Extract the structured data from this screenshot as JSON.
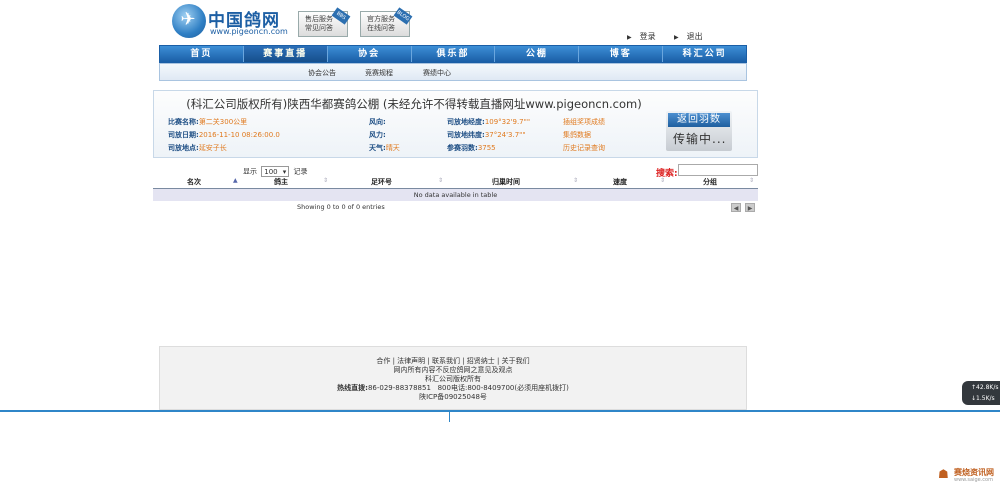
{
  "header": {
    "logo_cn": "中国鸽网",
    "logo_url": "www.pigeoncn.com",
    "service_buttons": [
      {
        "line1": "售后服务",
        "line2": "常见问答",
        "tag": "BBS"
      },
      {
        "line1": "官方服务",
        "line2": "在线问答",
        "tag": "BLOG"
      }
    ],
    "login": "登录",
    "logout": "退出"
  },
  "nav": {
    "items": [
      "首页",
      "赛事直播",
      "协会",
      "俱乐部",
      "公棚",
      "博客",
      "科汇公司"
    ],
    "active_index": 1,
    "sub_items": [
      "协会公告",
      "竞赛规程",
      "赛绩中心"
    ]
  },
  "race_info": {
    "title": "(科汇公司版权所有)陕西华都赛鸽公棚 (未经允许不得转载直播网址www.pigeoncn.com)",
    "race_name_label": "比赛名称:",
    "race_name": "第二关300公里",
    "release_date_label": "司放日期:",
    "release_date": "2016-11-10 08:26:00.0",
    "release_place_label": "司放地点:",
    "release_place": "延安子长",
    "wind_dir_label": "风向:",
    "wind_dir": "",
    "wind_force_label": "风力:",
    "wind_force": "",
    "weather_label": "天气:",
    "weather": "晴天",
    "longitude_label": "司放地经度:",
    "longitude": "109°32'9.7\"\"",
    "latitude_label": "司放地纬度:",
    "latitude": "37°24'3.7\"\"",
    "count_label": "参赛羽数:",
    "count": "3755",
    "link1": "插组奖项成绩",
    "link2": "集鸽数据",
    "link3": "历史记录查询",
    "return_label": "返回羽数",
    "transmitting": "传输中..."
  },
  "table": {
    "show_label": "显示",
    "page_size": "100",
    "records_label": "记录",
    "search_label": "搜索:",
    "columns": [
      "名次",
      "鸽主",
      "足环号",
      "归巢时间",
      "速度",
      "分组"
    ],
    "empty_text": "No data available in table",
    "info_text": "Showing 0 to 0 of 0 entries"
  },
  "footer": {
    "links": "合作 | 法律声明 | 联系我们 | 招贤纳士 | 关于我们",
    "line2": "网内所有内容不反应鸽网之意见及观点",
    "line3": "科汇公司版权所有",
    "hotline_label": "热线直拨:",
    "hotline": "86-029-88378851",
    "tel_label": "800电话:",
    "tel": "800-8409700(必须用座机拨打)",
    "icp": "陕ICP备09025048号"
  },
  "widget": {
    "up": "42.8K/s",
    "down": "1.5K/s"
  },
  "watermark": {
    "name": "赛烧资讯网",
    "url": "www.saige.com"
  }
}
